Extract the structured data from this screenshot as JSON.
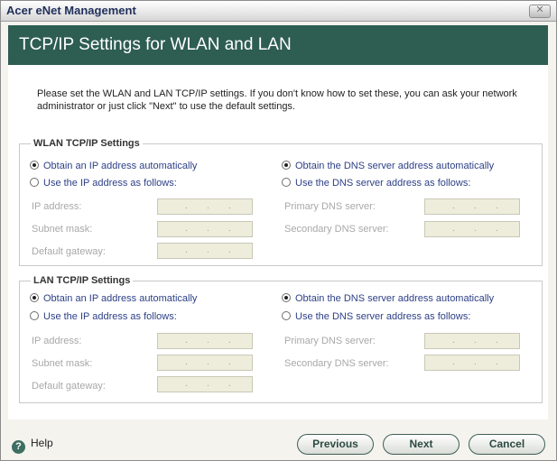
{
  "window": {
    "title": "Acer eNet Management",
    "close_glyph": "✕"
  },
  "header": {
    "title": "TCP/IP Settings for WLAN and LAN"
  },
  "intro": "Please set the WLAN and LAN TCP/IP settings. If you don't know how to set these, you can ask your network administrator or just click \"Next\" to use the default settings.",
  "wlan": {
    "title": "WLAN TCP/IP Settings",
    "ip_auto": "Obtain an IP address automatically",
    "ip_manual": "Use the IP address as follows:",
    "dns_auto": "Obtain the DNS server address automatically",
    "dns_manual": "Use the DNS server address as follows:",
    "ip_label": "IP address:",
    "subnet_label": "Subnet mask:",
    "gateway_label": "Default gateway:",
    "primary_dns_label": "Primary DNS server:",
    "secondary_dns_label": "Secondary DNS server:",
    "ip_mode": "auto",
    "dns_mode": "auto"
  },
  "lan": {
    "title": "LAN TCP/IP Settings",
    "ip_auto": "Obtain an IP address automatically",
    "ip_manual": "Use the IP address as follows:",
    "dns_auto": "Obtain the DNS server address automatically",
    "dns_manual": "Use the DNS server address as follows:",
    "ip_label": "IP address:",
    "subnet_label": "Subnet mask:",
    "gateway_label": "Default gateway:",
    "primary_dns_label": "Primary DNS server:",
    "secondary_dns_label": "Secondary DNS server:",
    "ip_mode": "auto",
    "dns_mode": "auto"
  },
  "ip_dot": ".",
  "footer": {
    "help_label": "Help",
    "help_icon": "?",
    "previous": "Previous",
    "next": "Next",
    "cancel": "Cancel"
  },
  "colors": {
    "header_bg": "#2e5d52",
    "radio_text": "#2c3f86",
    "field_bg": "#eeeddc"
  }
}
